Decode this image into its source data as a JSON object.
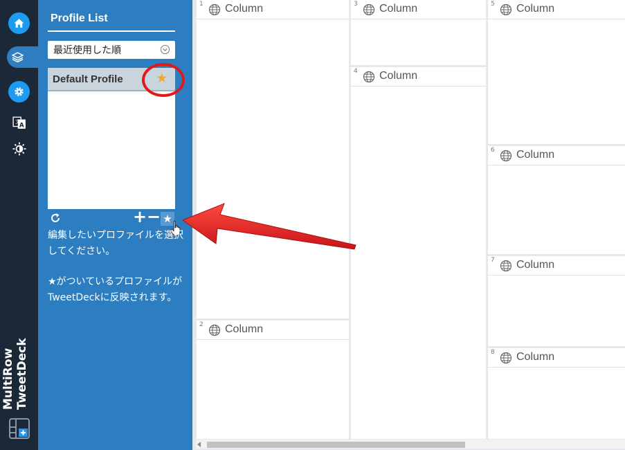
{
  "app": {
    "title_line1": "MultiRow",
    "title_line2": "TweetDeck"
  },
  "rail": {
    "items": [
      {
        "name": "home",
        "icon": "home-icon"
      },
      {
        "name": "profiles",
        "icon": "layers-icon",
        "active": true
      },
      {
        "name": "settings",
        "icon": "gear-icon"
      },
      {
        "name": "language",
        "icon": "translate-icon"
      },
      {
        "name": "theme",
        "icon": "brightness-icon"
      }
    ]
  },
  "panel": {
    "title": "Profile List",
    "sort_value": "最近使用した順",
    "profiles": [
      {
        "name": "Default Profile",
        "is_default": true
      }
    ],
    "controls": {
      "add": "+",
      "remove": "−",
      "default_star": "★"
    },
    "help_text_1": "編集したいプロファイルを選択してください。",
    "help_text_2": "★がついているプロファイルがTweetDeckに反映されます。"
  },
  "columns": [
    {
      "num": "1",
      "label": "Column"
    },
    {
      "num": "2",
      "label": "Column"
    },
    {
      "num": "3",
      "label": "Column"
    },
    {
      "num": "4",
      "label": "Column"
    },
    {
      "num": "5",
      "label": "Column"
    },
    {
      "num": "6",
      "label": "Column"
    },
    {
      "num": "7",
      "label": "Column"
    },
    {
      "num": "8",
      "label": "Column"
    }
  ],
  "colors": {
    "rail_bg": "#1b2838",
    "panel_bg": "#2c7ec0",
    "accent_blue": "#1d9bf0",
    "star": "#f5a623",
    "annotation_red": "#e0191c"
  }
}
